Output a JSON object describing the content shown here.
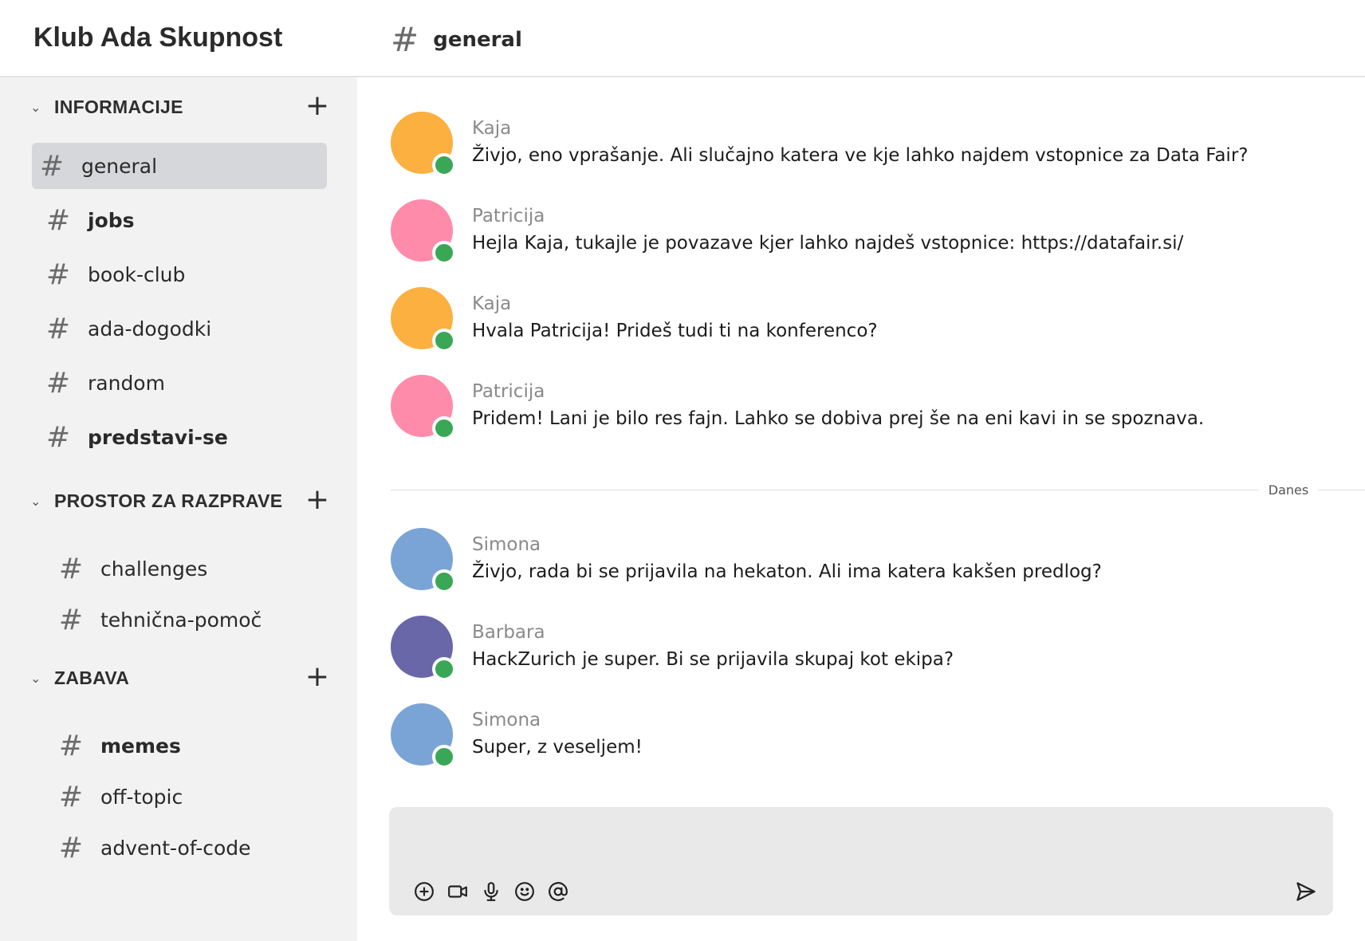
{
  "workspace": {
    "name": "Klub Ada Skupnost"
  },
  "header": {
    "hash": "#",
    "channel": "general"
  },
  "sidebar": {
    "sections": [
      {
        "label": "INFORMACIJE",
        "channels": [
          {
            "name": "general",
            "active": true,
            "bold": false
          },
          {
            "name": "jobs",
            "active": false,
            "bold": true
          },
          {
            "name": "book-club",
            "active": false,
            "bold": false
          },
          {
            "name": "ada-dogodki",
            "active": false,
            "bold": false
          },
          {
            "name": "random",
            "active": false,
            "bold": false
          },
          {
            "name": "predstavi-se",
            "active": false,
            "bold": true
          }
        ]
      },
      {
        "label": "PROSTOR ZA RAZPRAVE",
        "channels": [
          {
            "name": "challenges",
            "active": false,
            "bold": false
          },
          {
            "name": "tehnična-pomoč",
            "active": false,
            "bold": false
          }
        ]
      },
      {
        "label": "ZABAVA",
        "channels": [
          {
            "name": "memes",
            "active": false,
            "bold": true
          },
          {
            "name": "off-topic",
            "active": false,
            "bold": false
          },
          {
            "name": "advent-of-code",
            "active": false,
            "bold": false
          }
        ]
      }
    ]
  },
  "messages": [
    {
      "author": "Kaja",
      "text": "Živjo, eno vprašanje. Ali slučajno katera ve kje lahko najdem vstopnice za Data Fair?",
      "avatar_color": "#fbb040"
    },
    {
      "author": "Patricija",
      "text": "Hejla Kaja, tukajle je povazave kjer lahko najdeš vstopnice: https://datafair.si/",
      "avatar_color": "#ff8bab"
    },
    {
      "author": "Kaja",
      "text": "Hvala Patricija! Prideš tudi ti na konferenco?",
      "avatar_color": "#fbb040"
    },
    {
      "author": "Patricija",
      "text": "Pridem! Lani je bilo res fajn. Lahko se dobiva prej še na eni kavi in se spoznava.",
      "avatar_color": "#ff8bab"
    },
    {
      "author": "Simona",
      "text": "Živjo, rada bi se prijavila na hekaton. Ali ima katera kakšen predlog?",
      "avatar_color": "#7ba4d6"
    },
    {
      "author": "Barbara",
      "text": "HackZurich je super. Bi se prijavila skupaj kot ekipa?",
      "avatar_color": "#6a67a8"
    },
    {
      "author": "Simona",
      "text": "Super, z veseljem!",
      "avatar_color": "#7ba4d6"
    }
  ],
  "divider": {
    "label": "Danes"
  },
  "composer": {
    "value": "",
    "placeholder": ""
  },
  "colors": {
    "presence": "#3aa757",
    "active_channel": "#d6d7da",
    "sidebar_bg": "#f2f2f2"
  },
  "icons": {
    "toolbar": [
      "plus-circle-icon",
      "video-camera-icon",
      "microphone-icon",
      "emoji-icon",
      "mention-icon"
    ],
    "send": "send-icon"
  }
}
